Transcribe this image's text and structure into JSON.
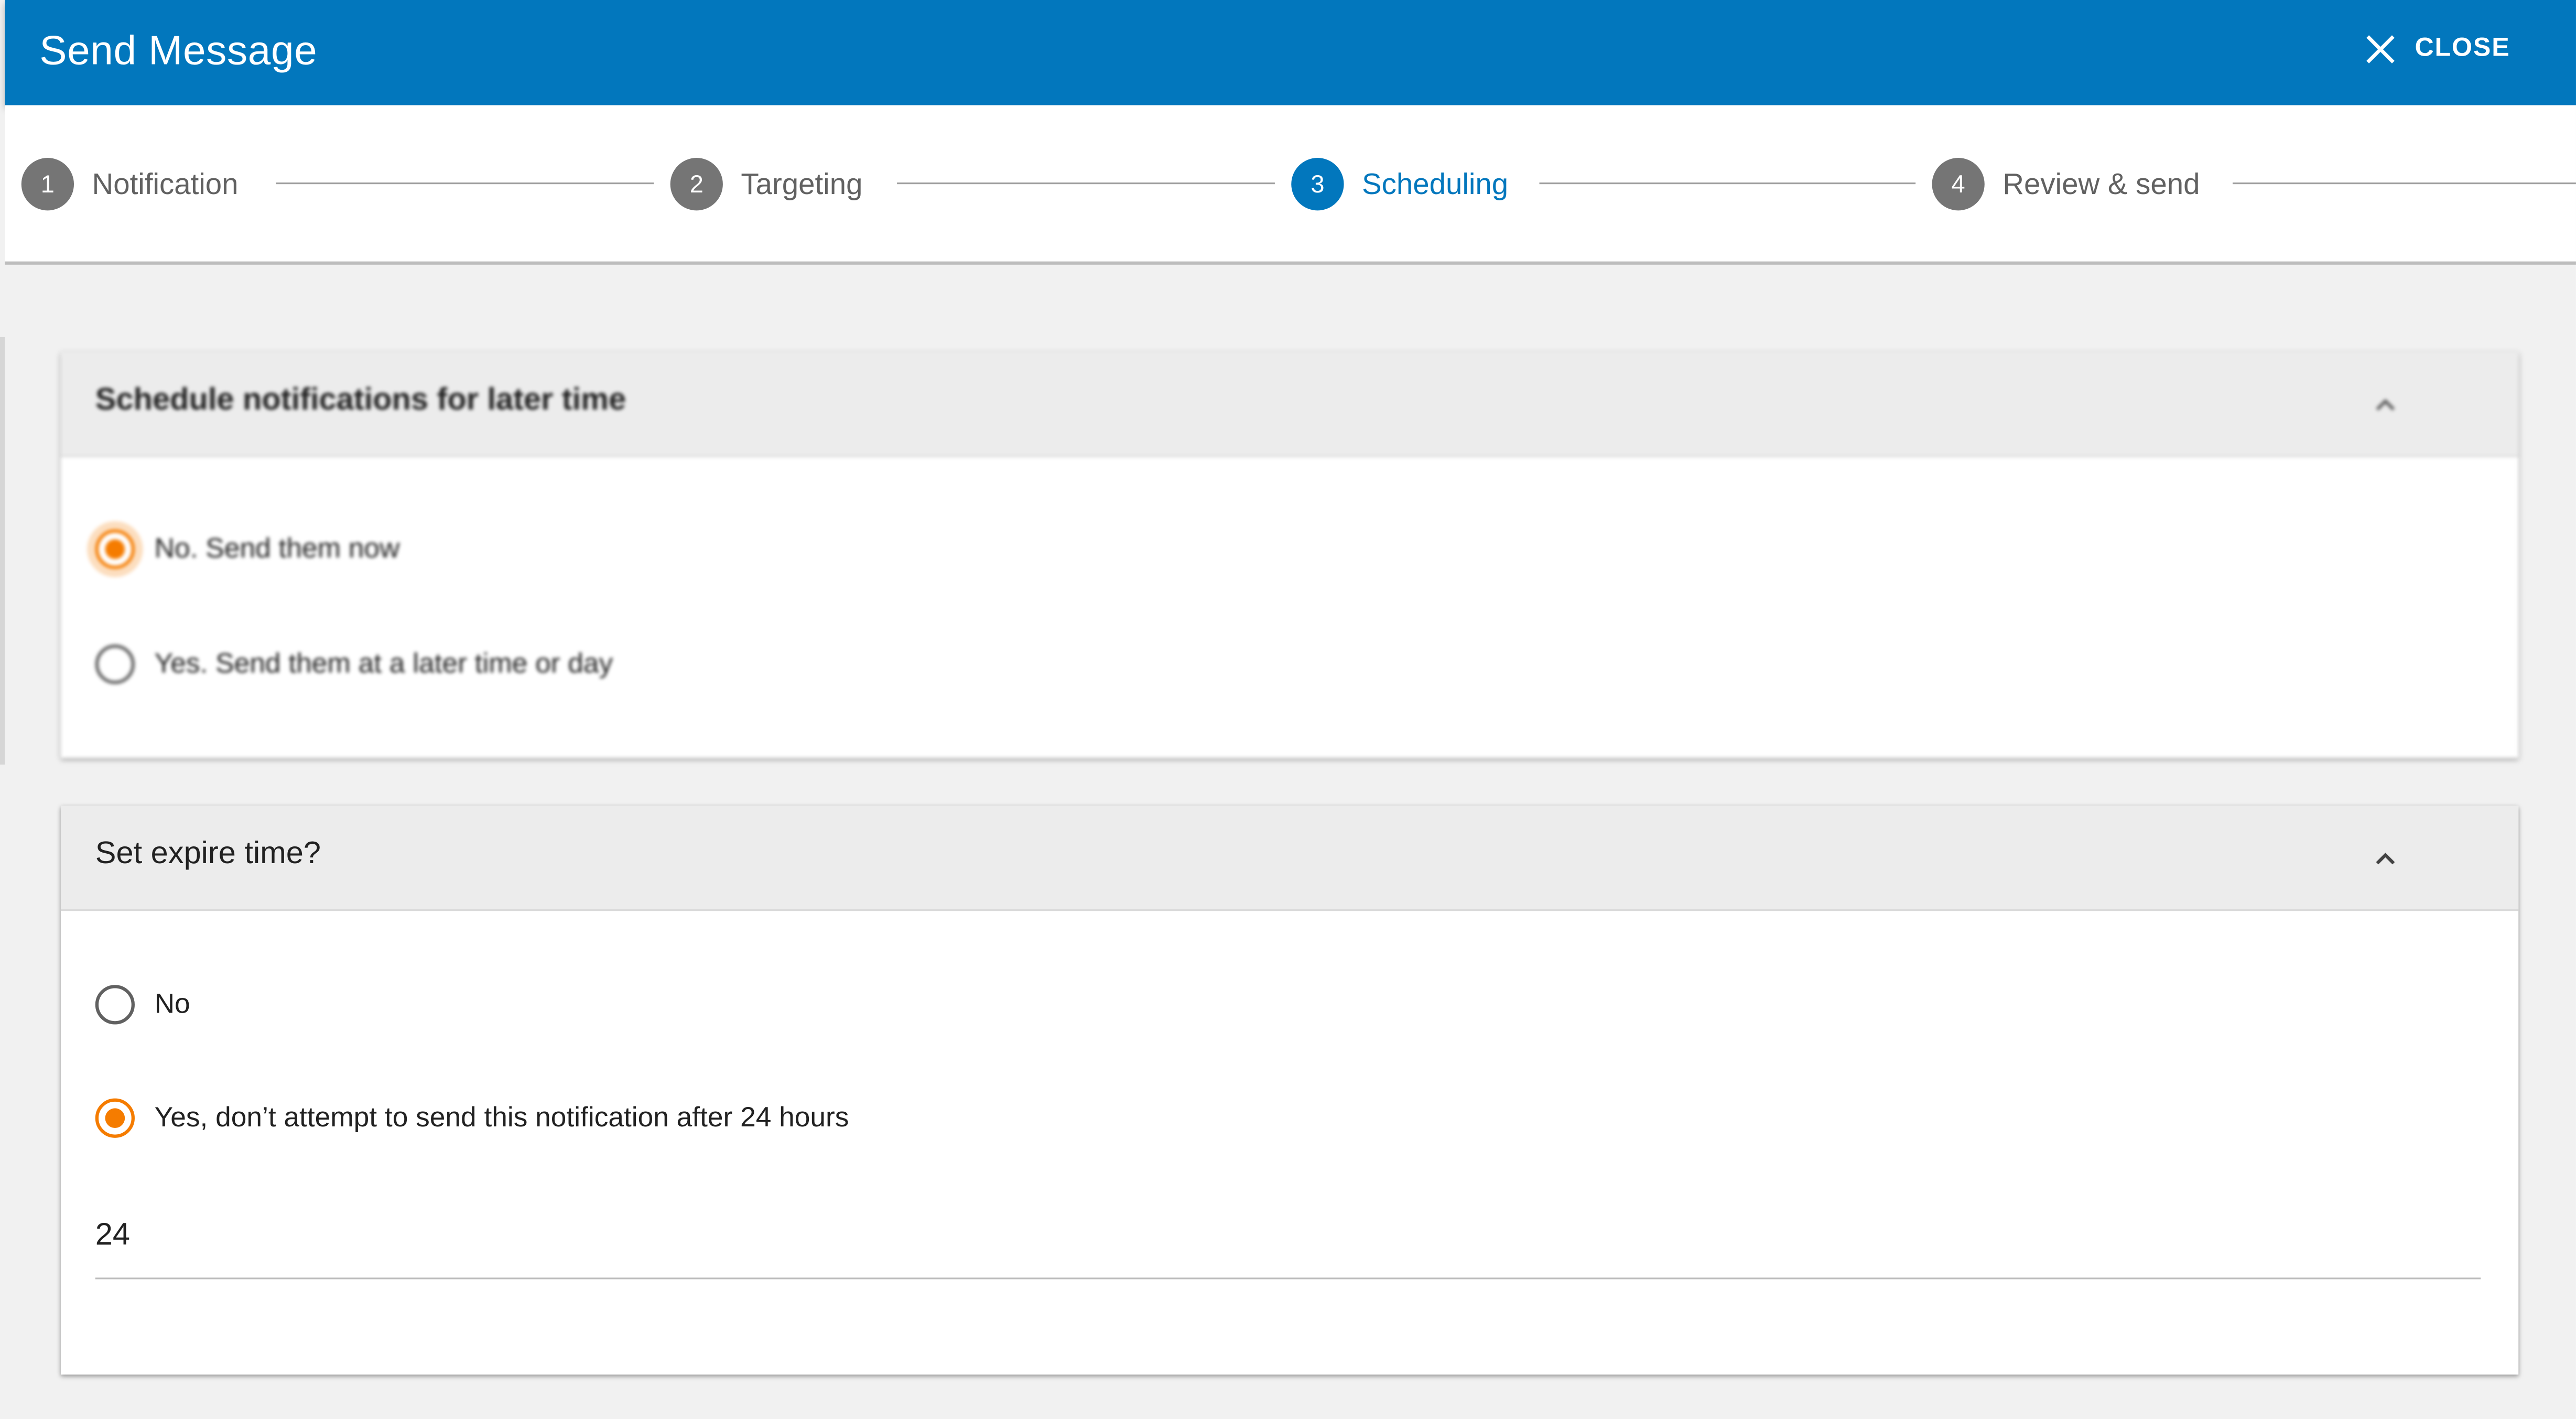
{
  "header": {
    "title": "Send Message",
    "close_label": "CLOSE",
    "background": "#0277bd"
  },
  "stepper": {
    "steps": [
      {
        "number": "1",
        "label": "Notification",
        "active": false
      },
      {
        "number": "2",
        "label": "Targeting",
        "active": false
      },
      {
        "number": "3",
        "label": "Scheduling",
        "active": true
      },
      {
        "number": "4",
        "label": "Review & send",
        "active": false
      }
    ]
  },
  "schedule_panel": {
    "title": "Schedule notifications for later time",
    "options": [
      {
        "label": "No. Send them now",
        "checked": true
      },
      {
        "label": "Yes. Send them at a later time or day",
        "checked": false
      }
    ]
  },
  "expire_panel": {
    "title": "Set expire time?",
    "options": [
      {
        "label": "No",
        "checked": false
      },
      {
        "label": "Yes, don’t attempt to send this notification after 24 hours",
        "checked": true
      }
    ],
    "hours_value": "24"
  },
  "colors": {
    "accent": "#f57c00",
    "primary": "#0277bd"
  }
}
